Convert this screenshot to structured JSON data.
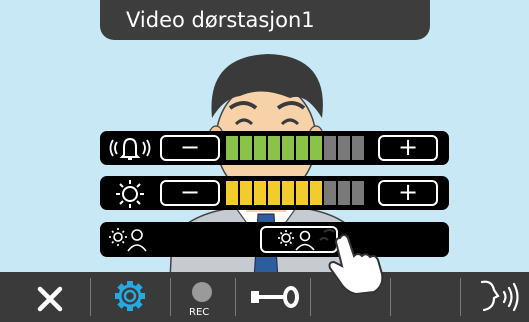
{
  "title": "Video dørstasjon1",
  "controls": [
    {
      "name": "ring-volume",
      "icon": "bell-volume-icon",
      "level": 7,
      "segments": 10,
      "fill_color": "#8bc34a",
      "off_color": "#7a7a7a"
    },
    {
      "name": "brightness",
      "icon": "brightness-icon",
      "level": 7,
      "segments": 10,
      "fill_color": "#f2cc2c",
      "off_color": "#7a7a7a"
    },
    {
      "name": "backlight-compensation",
      "icon": "backlight-person-icon"
    }
  ],
  "toolbar": {
    "items": [
      "close-icon",
      "settings-icon",
      "record-icon",
      "door-release-icon",
      "talk-icon"
    ],
    "rec_label": "REC",
    "accent": "#29a8e0"
  }
}
